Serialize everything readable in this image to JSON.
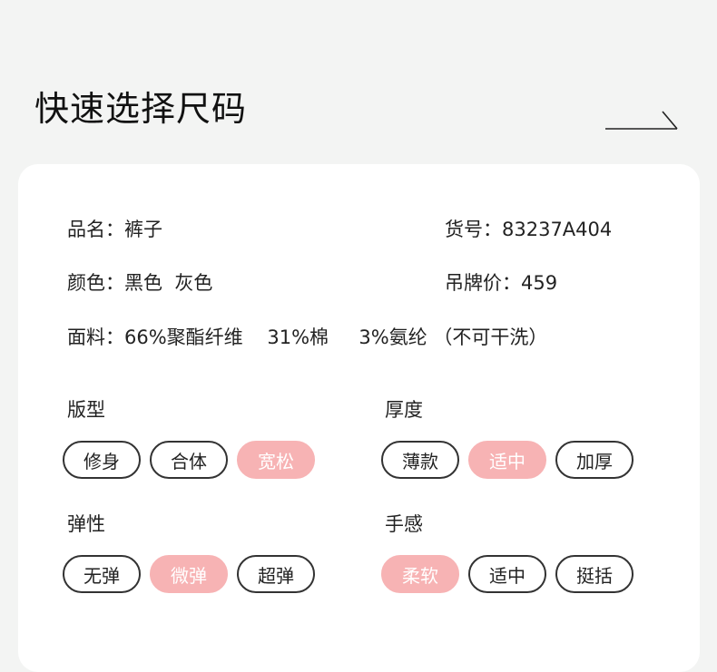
{
  "header": {
    "title": "快速选择尺码"
  },
  "info": {
    "name_label": "品名：",
    "name_value": "裤子",
    "sku_label": "货号：",
    "sku_value": "83237A404",
    "color_label": "颜色：",
    "color_value": "黑色  灰色",
    "price_label": "吊牌价：",
    "price_value": "459",
    "fabric_label": "面料：",
    "fabric_value": "66%聚酯纤维    31%棉     3%氨纶 （不可干洗）"
  },
  "groups": {
    "fit": {
      "title": "版型",
      "options": [
        "修身",
        "合体",
        "宽松"
      ],
      "selected": "宽松"
    },
    "thickness": {
      "title": "厚度",
      "options": [
        "薄款",
        "适中",
        "加厚"
      ],
      "selected": "适中"
    },
    "elasticity": {
      "title": "弹性",
      "options": [
        "无弹",
        "微弹",
        "超弹"
      ],
      "selected": "微弹"
    },
    "feel": {
      "title": "手感",
      "options": [
        "柔软",
        "适中",
        "挺括"
      ],
      "selected": "柔软"
    }
  },
  "colors": {
    "selected_chip": "#f7b3b4",
    "background": "#f3f4f3",
    "card": "#ffffff"
  },
  "icons": {
    "header_arrow": "arrow-right-icon"
  }
}
